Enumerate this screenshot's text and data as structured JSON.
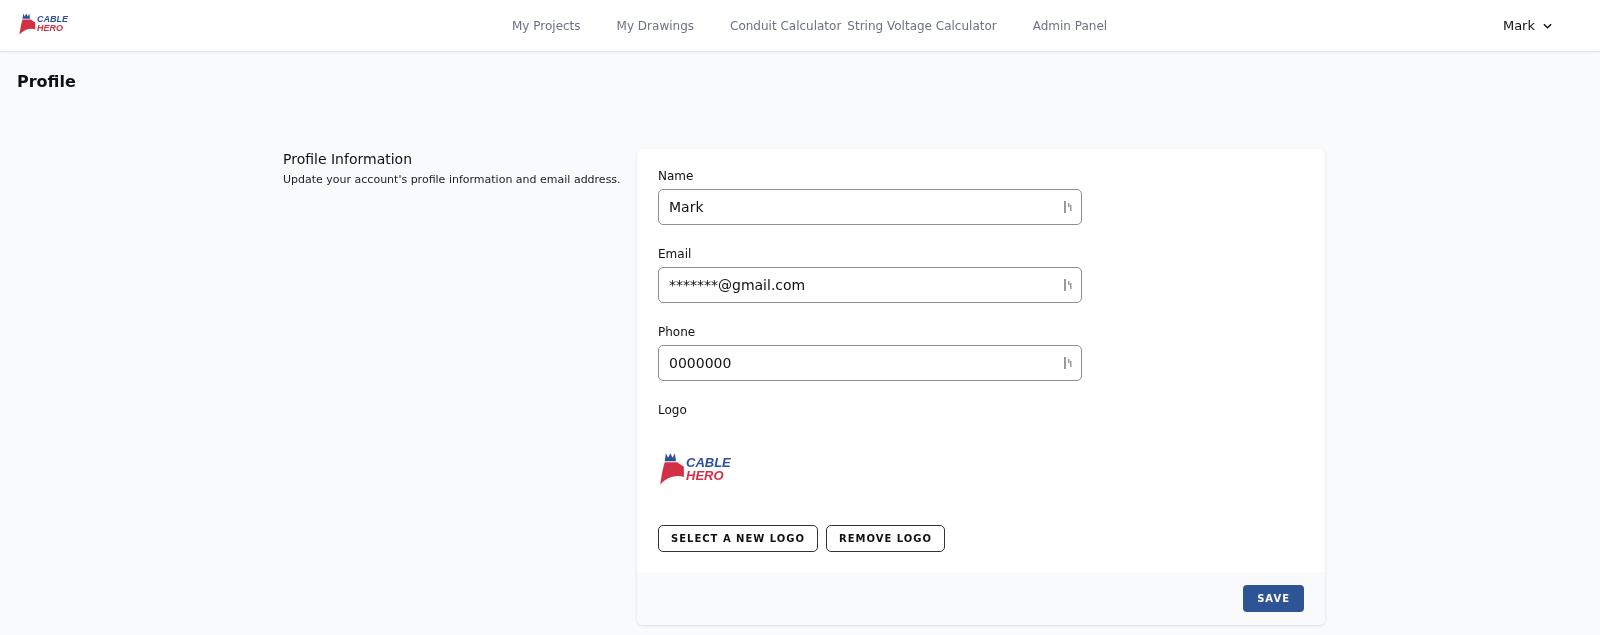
{
  "header": {
    "logo_lines": [
      "CABLE",
      "HERO"
    ],
    "nav": [
      {
        "label": "My Projects"
      },
      {
        "label": "My Drawings"
      },
      {
        "label": "Conduit Calculator"
      },
      {
        "label": "String Voltage Calculator"
      },
      {
        "label": "Admin Panel"
      }
    ],
    "user": "Mark"
  },
  "page_title": "Profile",
  "section": {
    "title": "Profile Information",
    "description": "Update your account's profile information and email address."
  },
  "fields": [
    {
      "label": "Name",
      "value": "Mark"
    },
    {
      "label": "Email",
      "value": "*******@gmail.com"
    },
    {
      "label": "Phone",
      "value": "0000000"
    }
  ],
  "logo": {
    "label": "Logo",
    "logo_lines": [
      "CABLE",
      "HERO"
    ],
    "buttons": [
      "SELECT A NEW LOGO",
      "REMOVE LOGO"
    ]
  },
  "save_button": "SAVE"
}
